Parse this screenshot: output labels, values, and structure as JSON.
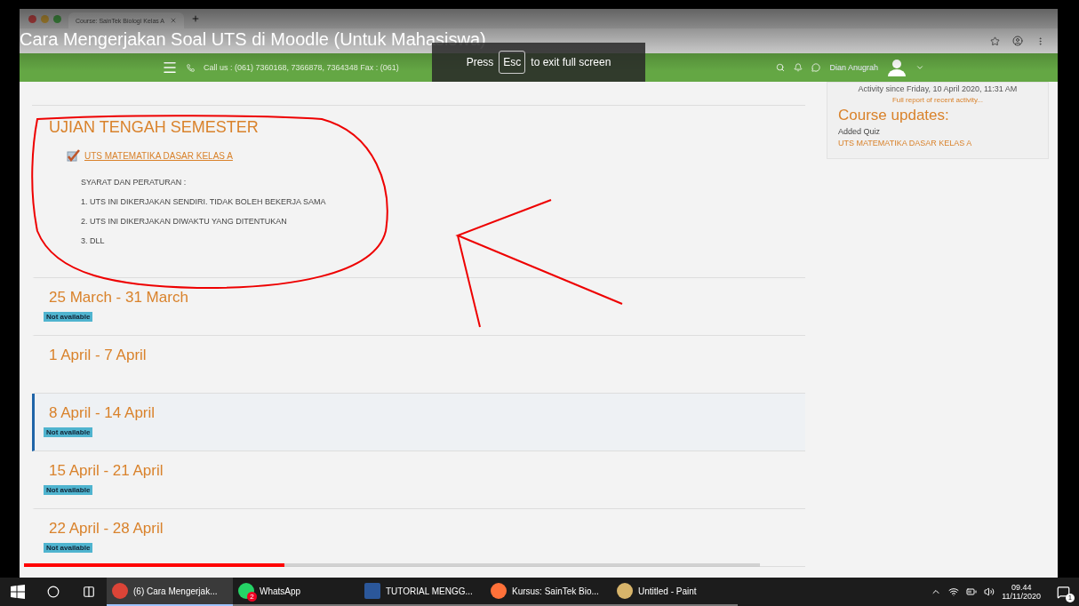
{
  "video": {
    "title": "Cara Mengerjakan Soal UTS di Moodle (Untuk Mahasiswa)",
    "fullscreen_hint": {
      "before": "Press",
      "key": "Esc",
      "after": "to exit full screen"
    },
    "progress": {
      "level": 0.354
    }
  },
  "browser": {
    "tab_title": "Course: SainTek Biologi Kelas A"
  },
  "navbar": {
    "contact": "Call us : (061) 7360168, 7366878, 7364348 Fax : (061)",
    "user": "Dian Anugrah"
  },
  "sections": [
    {
      "title": "UJIAN TENGAH SEMESTER",
      "current": false,
      "activity": {
        "name": "UTS MATEMATIKA DASAR KELAS A",
        "checked": true
      },
      "description": [
        "SYARAT DAN PERATURAN :",
        "1. UTS INI DIKERJAKAN SENDIRI. TIDAK BOLEH BEKERJA SAMA",
        "2. UTS INI DIKERJAKAN DIWAKTU YANG DITENTUKAN",
        "3. DLL"
      ]
    },
    {
      "title": "25 March - 31 March",
      "current": false,
      "badge": "Not available"
    },
    {
      "title": "1 April - 7 April",
      "current": false
    },
    {
      "title": "8 April - 14 April",
      "current": true,
      "badge": "Not available"
    },
    {
      "title": "15 April - 21 April",
      "current": false,
      "badge": "Not available"
    },
    {
      "title": "22 April - 28 April",
      "current": false,
      "badge": "Not available"
    }
  ],
  "recent_activity": {
    "since": "Activity since Friday, 10 April 2020, 11:31 AM",
    "report_link": "Full report of recent activity...",
    "heading": "Course updates:",
    "update_type": "Added Quiz",
    "update_link": "UTS MATEMATIKA DASAR KELAS A"
  },
  "taskbar": {
    "apps": [
      {
        "label": "(6) Cara Mengerjak...",
        "kind": "chrome",
        "selected": true
      },
      {
        "label": "WhatsApp",
        "kind": "whatsapp",
        "badge": "2",
        "selected": false
      },
      {
        "label": "TUTORIAL MENGG...",
        "kind": "word",
        "selected": false
      },
      {
        "label": "Kursus: SainTek Bio...",
        "kind": "firefox",
        "selected": false
      },
      {
        "label": "Untitled - Paint",
        "kind": "paint",
        "selected": false
      }
    ],
    "time": "09.44",
    "date": "11/11/2020",
    "notifications": "1"
  }
}
